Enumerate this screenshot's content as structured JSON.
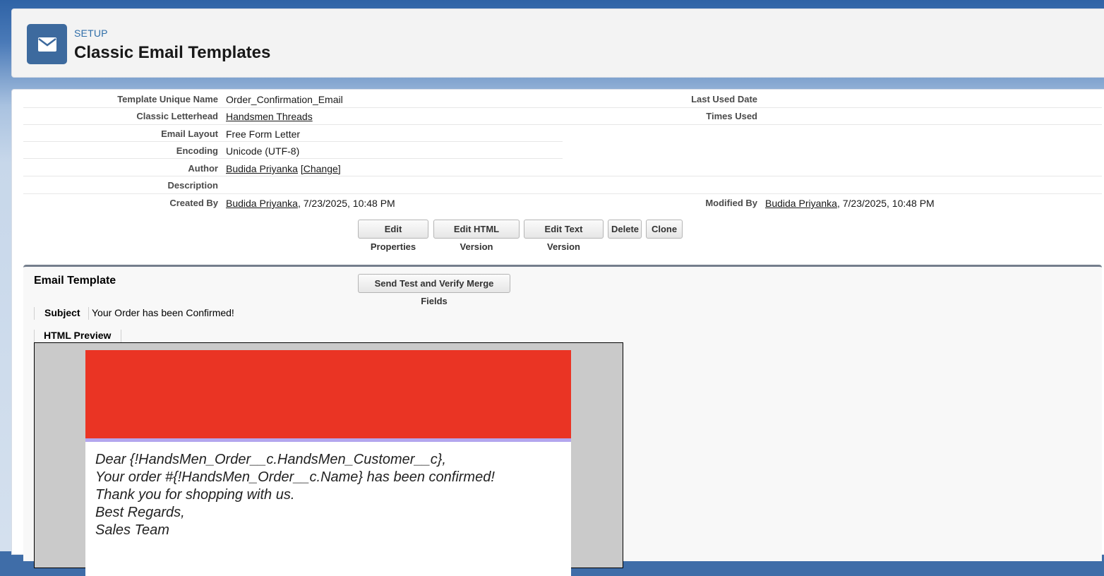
{
  "header": {
    "breadcrumb": "SETUP",
    "title": "Classic Email Templates",
    "icon": "email-icon"
  },
  "details": {
    "template_unique_name": {
      "label": "Template Unique Name",
      "value": "Order_Confirmation_Email"
    },
    "classic_letterhead": {
      "label": "Classic Letterhead",
      "value": "Handsmen Threads"
    },
    "email_layout": {
      "label": "Email Layout",
      "value": "Free Form Letter"
    },
    "encoding": {
      "label": "Encoding",
      "value": "Unicode (UTF-8)"
    },
    "author": {
      "label": "Author",
      "value": "Budida Priyanka",
      "change_link": "[Change]"
    },
    "description": {
      "label": "Description",
      "value": ""
    },
    "created_by": {
      "label": "Created By",
      "user": "Budida Priyanka",
      "timestamp": ", 7/23/2025, 10:48 PM"
    },
    "last_used_date": {
      "label": "Last Used Date",
      "value": ""
    },
    "times_used": {
      "label": "Times Used",
      "value": ""
    },
    "modified_by": {
      "label": "Modified By",
      "user": "Budida Priyanka",
      "timestamp": ", 7/23/2025, 10:48 PM"
    }
  },
  "actions": {
    "edit_properties": "Edit Properties",
    "edit_html_version": "Edit HTML Version",
    "edit_text_version": "Edit Text Version",
    "delete": "Delete",
    "clone": "Clone"
  },
  "email_template_section": {
    "title": "Email Template",
    "send_test_button": "Send Test and Verify Merge Fields",
    "subject_label": "Subject",
    "subject_value": "Your Order has been Confirmed!",
    "preview_tab": "HTML Preview",
    "preview": {
      "banner_color": "#ea3424",
      "stripe_color": "#b3a6ee",
      "lines": [
        "Dear {!HandsMen_Order__c.HandsMen_Customer__c},",
        "Your order #{!HandsMen_Order__c.Name} has been confirmed!",
        "Thank you for shopping with us.",
        "Best Regards,",
        "Sales Team"
      ]
    }
  },
  "colors": {
    "accent": "#3d6a9e",
    "setup_label": "#2f6ea8"
  }
}
